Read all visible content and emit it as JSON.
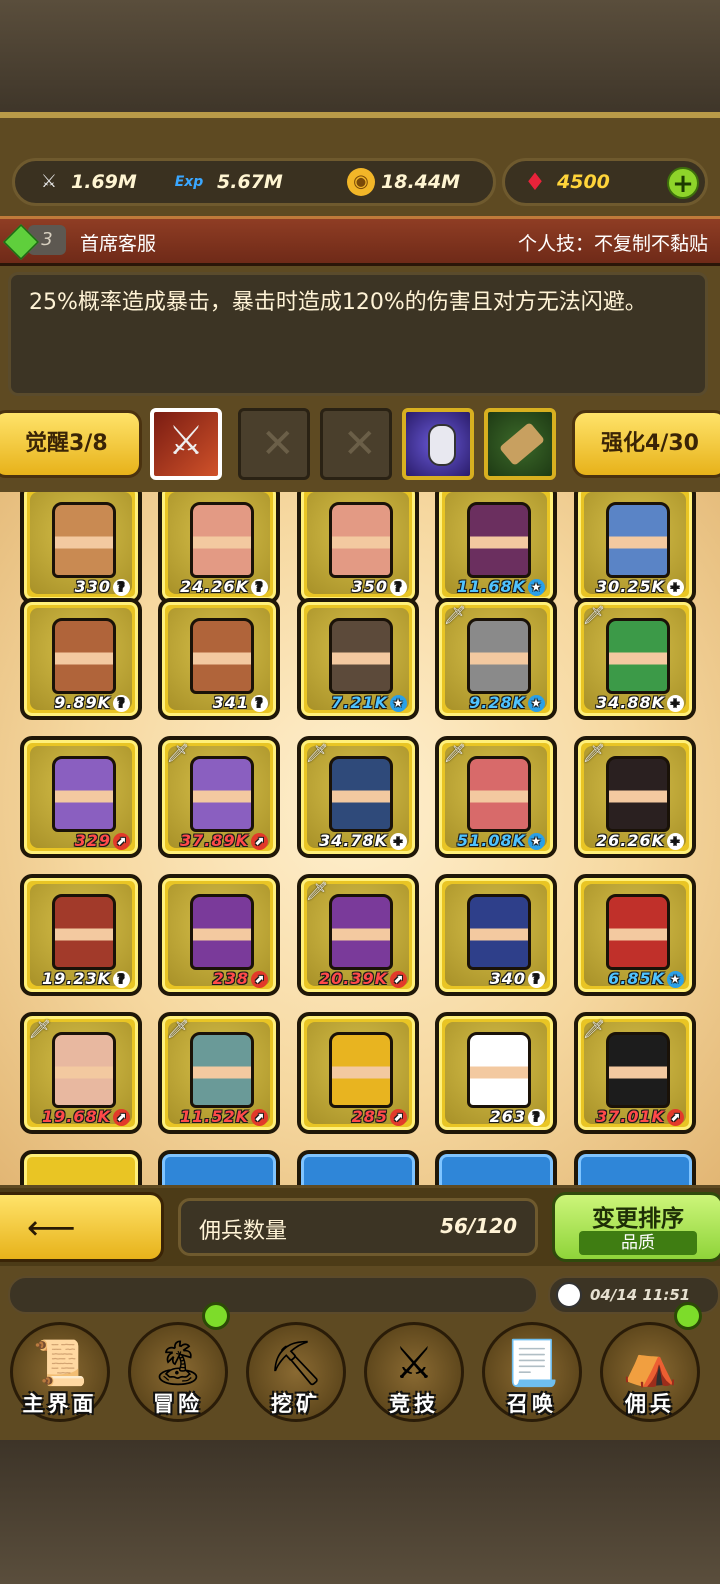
{
  "resources": {
    "attack": {
      "icon": "sword-icon",
      "value": "1.69M"
    },
    "exp": {
      "icon": "exp-icon",
      "label": "Exp",
      "value": "5.67M"
    },
    "gold": {
      "icon": "coin-icon",
      "value": "18.44M"
    },
    "gems": {
      "icon": "ruby-icon",
      "value": "4500"
    }
  },
  "skill": {
    "level": "3",
    "name": "首席客服",
    "type": "个人技：不复制不黏贴",
    "description": "25%概率造成暴击，暴击时造成120%的伤害且对方无法闪避。"
  },
  "awaken": {
    "label": "觉醒3/8"
  },
  "enhance": {
    "label": "强化4/30"
  },
  "skill_slots": [
    "crossed-swords-slot",
    "empty-slot",
    "empty-slot",
    "mouse-slot",
    "scroll-slot"
  ],
  "mercenaries": [
    {
      "value": "330",
      "mark": "?",
      "color": "white",
      "sword": false,
      "tone": "#c98a52"
    },
    {
      "value": "24.26K",
      "mark": "?",
      "color": "white",
      "sword": false,
      "tone": "#e39a84"
    },
    {
      "value": "350",
      "mark": "?",
      "color": "white",
      "sword": false,
      "tone": "#e39a84"
    },
    {
      "value": "11.68K",
      "mark": "★",
      "color": "blue",
      "sword": false,
      "tone": "#6b2f5f"
    },
    {
      "value": "30.25K",
      "mark": "+",
      "color": "white",
      "sword": false,
      "tone": "#5a84c6"
    },
    {
      "value": "9.89K",
      "mark": "?",
      "color": "white",
      "sword": false,
      "tone": "#b0643a"
    },
    {
      "value": "341",
      "mark": "?",
      "color": "white",
      "sword": false,
      "tone": "#b0643a"
    },
    {
      "value": "7.21K",
      "mark": "★",
      "color": "blue",
      "sword": false,
      "tone": "#5c4a3a"
    },
    {
      "value": "9.28K",
      "mark": "★",
      "color": "blue",
      "sword": true,
      "tone": "#8a8a8a"
    },
    {
      "value": "34.88K",
      "mark": "+",
      "color": "white",
      "sword": true,
      "tone": "#3c9a48"
    },
    {
      "value": "329",
      "mark": "⬈",
      "color": "red",
      "sword": false,
      "tone": "#8a5fc0"
    },
    {
      "value": "37.89K",
      "mark": "⬈",
      "color": "red",
      "sword": true,
      "tone": "#8a5fc0"
    },
    {
      "value": "34.78K",
      "mark": "+",
      "color": "white",
      "sword": true,
      "tone": "#2f4a7a"
    },
    {
      "value": "51.08K",
      "mark": "★",
      "color": "blue",
      "sword": true,
      "tone": "#d86a6a"
    },
    {
      "value": "26.26K",
      "mark": "+",
      "color": "white",
      "sword": true,
      "tone": "#2a2020"
    },
    {
      "value": "19.23K",
      "mark": "?",
      "color": "white",
      "sword": false,
      "tone": "#a23a2a"
    },
    {
      "value": "238",
      "mark": "⬈",
      "color": "red",
      "sword": false,
      "tone": "#7a3a9a"
    },
    {
      "value": "20.39K",
      "mark": "⬈",
      "color": "red",
      "sword": true,
      "tone": "#7a3a9a"
    },
    {
      "value": "340",
      "mark": "?",
      "color": "white",
      "sword": false,
      "tone": "#2e3f8a"
    },
    {
      "value": "6.85K",
      "mark": "★",
      "color": "blue",
      "sword": false,
      "tone": "#c0302a"
    },
    {
      "value": "19.68K",
      "mark": "⬈",
      "color": "red",
      "sword": true,
      "tone": "#e8b8a0"
    },
    {
      "value": "11.52K",
      "mark": "⬈",
      "color": "red",
      "sword": true,
      "tone": "#6a9a98"
    },
    {
      "value": "285",
      "mark": "⬈",
      "color": "red",
      "sword": false,
      "tone": "#e8b420"
    },
    {
      "value": "263",
      "mark": "?",
      "color": "white",
      "sword": false,
      "tone": "#ffffff"
    },
    {
      "value": "37.01K",
      "mark": "⬈",
      "color": "red",
      "sword": true,
      "tone": "#1c1c1c"
    }
  ],
  "count": {
    "label": "佣兵数量",
    "value": "56/120"
  },
  "sort": {
    "label": "变更排序",
    "sub": "品质"
  },
  "clock": {
    "time": "04/14 11:51"
  },
  "nav": [
    {
      "label": "主界面",
      "icon": "map-scroll-icon",
      "dot": false
    },
    {
      "label": "冒险",
      "icon": "island-icon",
      "dot": true
    },
    {
      "label": "挖矿",
      "icon": "pickaxe-icon",
      "dot": false
    },
    {
      "label": "竞技",
      "icon": "crossed-swords-icon",
      "dot": false
    },
    {
      "label": "召唤",
      "icon": "summon-scroll-icon",
      "dot": false
    },
    {
      "label": "佣兵",
      "icon": "tent-icon",
      "dot": true
    }
  ]
}
